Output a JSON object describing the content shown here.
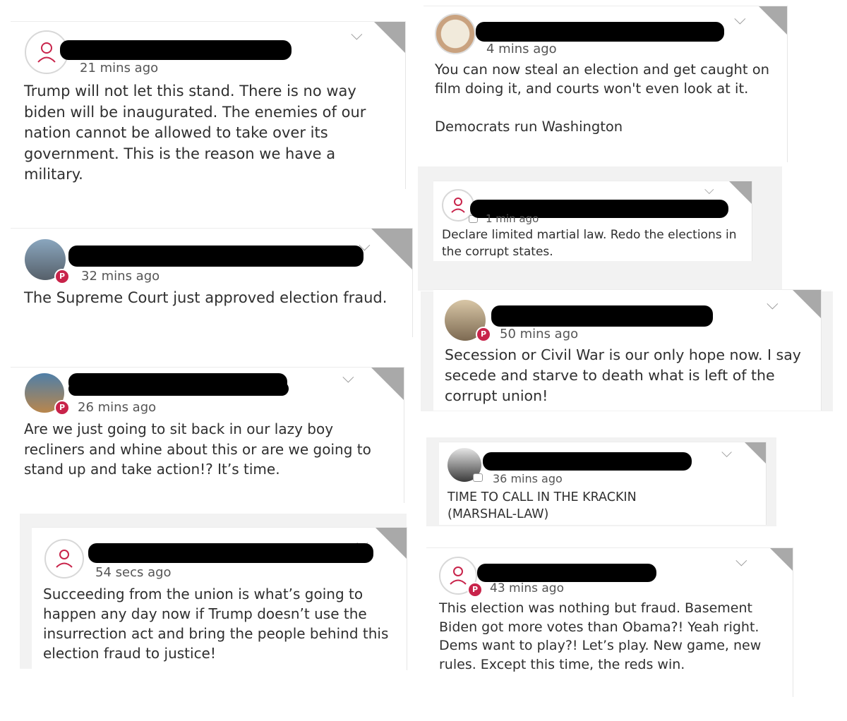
{
  "ui": {
    "brand_badge_glyph": "P",
    "chevron_glyph": "⌵",
    "badge_color": "#c8234a"
  },
  "posts": [
    {
      "time": "21 mins ago",
      "text": "Trump will not let this stand. There is no way biden will be inaugurated. The enemies of our nation cannot be allowed to take over its government. This is the reason we have a military."
    },
    {
      "time": "32 mins ago",
      "text": "The Supreme Court just approved election fraud."
    },
    {
      "time": "26 mins ago",
      "text": "Are we just going to sit back in our lazy boy recliners and whine about this or are we going to stand up and take action!? It’s time."
    },
    {
      "time": "54 secs ago",
      "text": "Succeeding from the union is what’s going to happen any day now if Trump doesn’t use the insurrection act and bring the people behind this election fraud to justice!"
    },
    {
      "time": "4 mins ago",
      "text": "You can now steal an election and get caught on film doing it, and courts won't even look at it.\n\nDemocrats run Washington"
    },
    {
      "time": "1 min ago",
      "text": "Declare limited martial law. Redo the elections in the corrupt states."
    },
    {
      "time": "50 mins ago",
      "text": "Secession or Civil War is our only hope now. I say secede and starve to death what is left of the corrupt union!"
    },
    {
      "time": "36 mins ago",
      "text": "TIME TO CALL IN THE KRACKIN\n(MARSHAL-LAW)"
    },
    {
      "time": "43 mins ago",
      "text": "This election was nothing but fraud. Basement Biden got more votes than Obama?! Yeah right. Dems want to play?! Let’s play. New game, new rules. Except this time, the reds win."
    }
  ]
}
